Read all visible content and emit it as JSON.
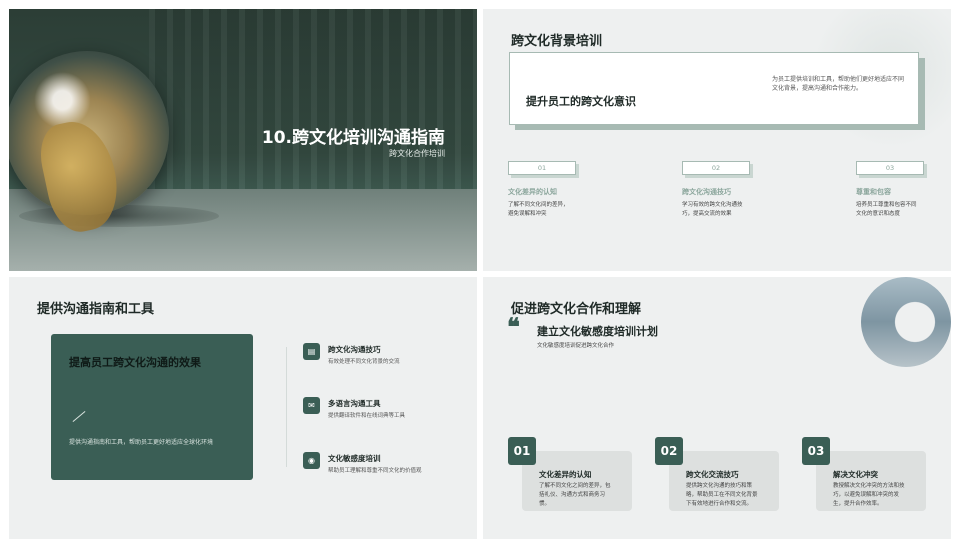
{
  "slide1": {
    "title": "10.跨文化培训沟通指南",
    "subtitle": "跨文化合作培训"
  },
  "slide2": {
    "title": "跨文化背景培训",
    "card_heading": "提升员工的跨文化意识",
    "card_desc": "为员工提供培训和工具，帮助他们更好地适应不同文化背景，提高沟通和合作能力。",
    "columns": [
      {
        "num": "01",
        "title": "文化差异的认知",
        "desc": "了解不同文化间的差异，避免误解和冲突"
      },
      {
        "num": "02",
        "title": "跨文化沟通技巧",
        "desc": "学习有效的跨文化沟通技巧，提高交流的效果"
      },
      {
        "num": "03",
        "title": "尊重和包容",
        "desc": "培养员工尊重和包容不同文化的意识和态度"
      }
    ]
  },
  "slide3": {
    "title": "提供沟通指南和工具",
    "panel_heading": "提高员工跨文化沟通的效果",
    "panel_desc": "提供沟通指南和工具，帮助员工更好地适应全球化环境",
    "items": [
      {
        "icon": "book-icon",
        "title": "跨文化沟通技巧",
        "desc": "有效处理不同文化背景的交流"
      },
      {
        "icon": "chat-icon",
        "title": "多语言沟通工具",
        "desc": "提供翻译软件和在线词典等工具"
      },
      {
        "icon": "target-icon",
        "title": "文化敏感度培训",
        "desc": "帮助员工理解和尊重不同文化的价值观"
      }
    ]
  },
  "slide4": {
    "title": "促进跨文化合作和理解",
    "quote_mark": "❝",
    "sub_heading": "建立文化敏感度培训计划",
    "sub_desc": "文化敏感度培训促进跨文化合作",
    "steps": [
      {
        "num": "01",
        "title": "文化差异的认知",
        "desc": "了解不同文化之间的差异，包括礼仪、沟通方式和商务习惯。"
      },
      {
        "num": "02",
        "title": "跨文化交流技巧",
        "desc": "提供跨文化沟通的技巧和策略，帮助员工在不同文化背景下有效地进行合作和交流。"
      },
      {
        "num": "03",
        "title": "解决文化冲突",
        "desc": "教授解决文化冲突的方法和技巧，以避免误解和冲突的发生，提升合作效率。"
      }
    ]
  },
  "colors": {
    "accent": "#3a5e55",
    "soft_accent": "#8aa59b",
    "slide_bg": "#eef0f0"
  }
}
